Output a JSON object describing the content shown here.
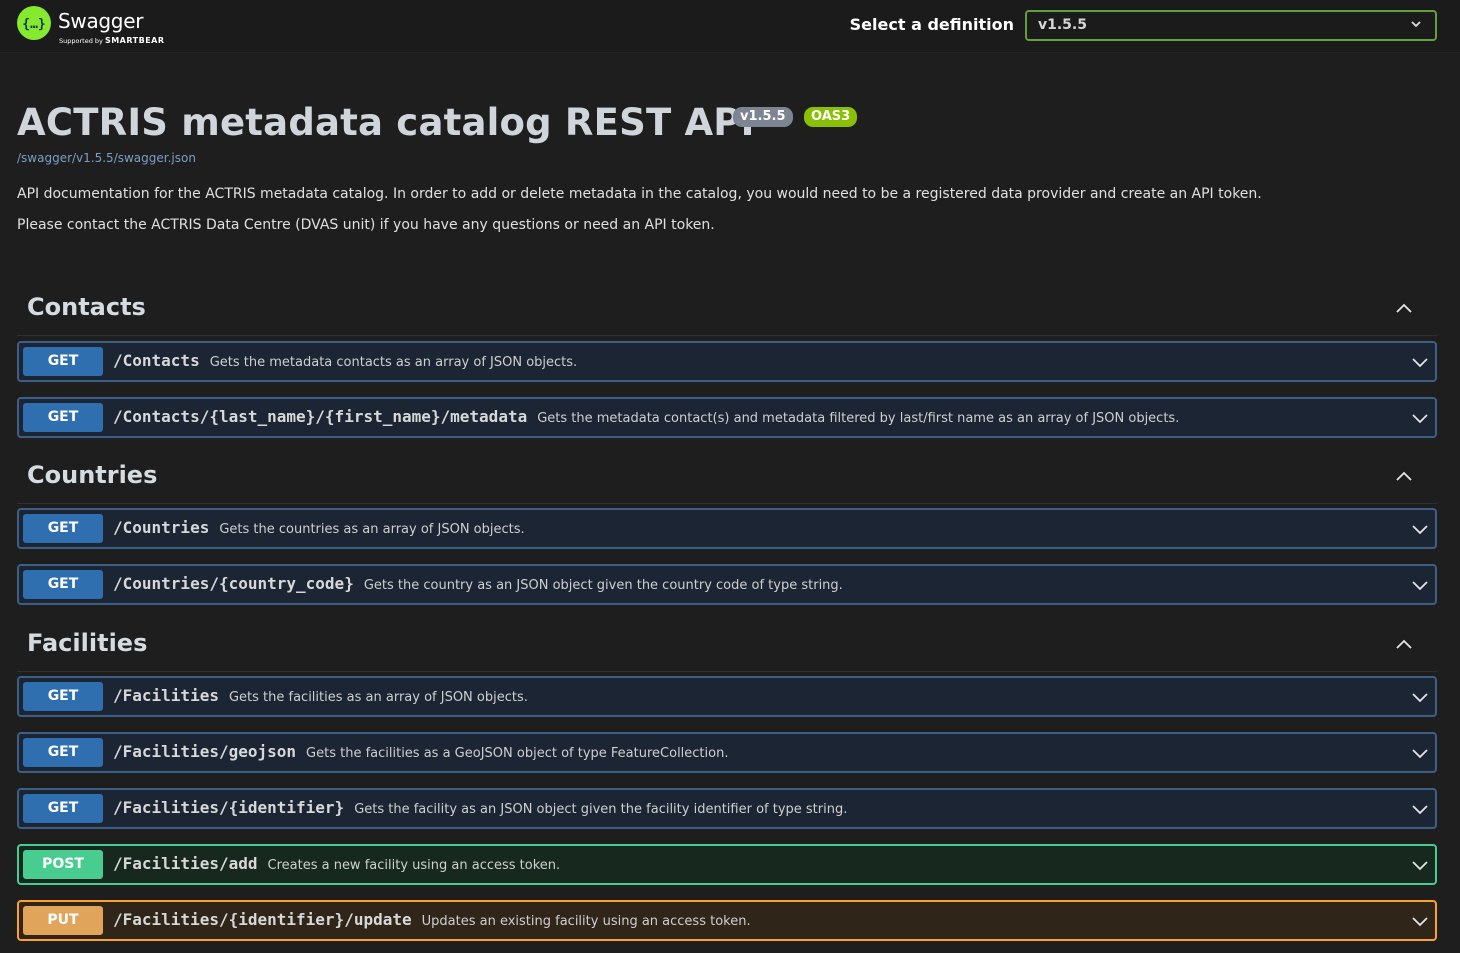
{
  "topbar": {
    "logo_name": "Swagger",
    "logo_sub_prefix": "Supported by",
    "logo_sub_brand": "SMARTBEAR",
    "definition_label": "Select a definition",
    "definition_value": "v1.5.5"
  },
  "info": {
    "title": "ACTRIS metadata catalog REST API",
    "version_badge": "v1.5.5",
    "oas_badge": "OAS3",
    "spec_link": "/swagger/v1.5.5/swagger.json",
    "description_1": "API documentation for the ACTRIS metadata catalog. In order to add or delete metadata in the catalog, you would need to be a registered data provider and create an API token.",
    "description_2": "Please contact the ACTRIS Data Centre (DVAS unit) if you have any questions or need an API token."
  },
  "sections": [
    {
      "name": "Contacts",
      "operations": [
        {
          "method": "GET",
          "path": "/Contacts",
          "summary": "Gets the metadata contacts as an array of JSON objects."
        },
        {
          "method": "GET",
          "path": "/Contacts/{last_name}/{first_name}/metadata",
          "summary": "Gets the metadata contact(s) and metadata filtered by last/first name as an array of JSON objects."
        }
      ]
    },
    {
      "name": "Countries",
      "operations": [
        {
          "method": "GET",
          "path": "/Countries",
          "summary": "Gets the countries as an array of JSON objects."
        },
        {
          "method": "GET",
          "path": "/Countries/{country_code}",
          "summary": "Gets the country as an JSON object given the country code of type string."
        }
      ]
    },
    {
      "name": "Facilities",
      "operations": [
        {
          "method": "GET",
          "path": "/Facilities",
          "summary": "Gets the facilities as an array of JSON objects."
        },
        {
          "method": "GET",
          "path": "/Facilities/geojson",
          "summary": "Gets the facilities as a GeoJSON object of type FeatureCollection."
        },
        {
          "method": "GET",
          "path": "/Facilities/{identifier}",
          "summary": "Gets the facility as an JSON object given the facility identifier of type string."
        },
        {
          "method": "POST",
          "path": "/Facilities/add",
          "summary": "Creates a new facility using an access token."
        },
        {
          "method": "PUT",
          "path": "/Facilities/{identifier}/update",
          "summary": "Updates an existing facility using an access token."
        }
      ]
    }
  ],
  "colors": {
    "get": "#2f6fb0",
    "post": "#49cc90",
    "put": "#fca130",
    "swagger_green": "#85ea2d"
  },
  "icons": {
    "logo": "swagger-logo-icon",
    "dropdown": "chevron-down-icon",
    "section_toggle": "chevron-up-icon",
    "op_toggle": "chevron-down-icon"
  }
}
